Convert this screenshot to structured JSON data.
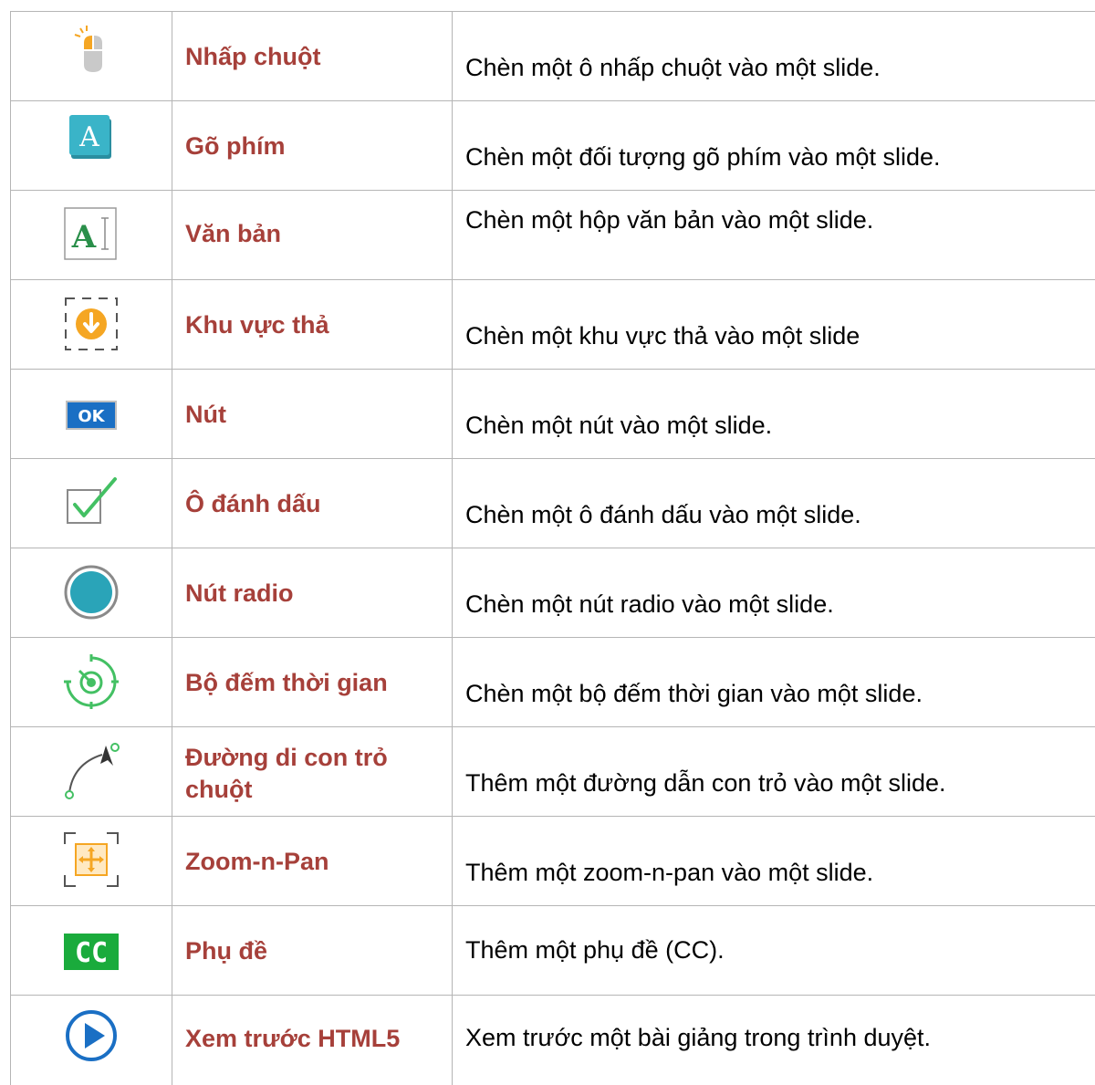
{
  "rows": [
    {
      "icon": "mouse-click-icon",
      "name": "Nhấp chuột",
      "desc": "Chèn một ô nhấp chuột vào một slide."
    },
    {
      "icon": "typing-icon",
      "name": "Gõ phím",
      "desc": "Chèn một đối tượng gõ phím vào một slide."
    },
    {
      "icon": "text-box-icon",
      "name": "Văn bản",
      "desc": "Chèn một hộp văn bản vào một slide."
    },
    {
      "icon": "drop-area-icon",
      "name": "Khu vực thả",
      "desc": "Chèn một khu vực thả vào một slide"
    },
    {
      "icon": "ok-button-icon",
      "name": "Nút",
      "desc": "Chèn một nút vào một slide."
    },
    {
      "icon": "checkbox-icon",
      "name": "Ô đánh dấu",
      "desc": "Chèn một ô đánh dấu vào một slide."
    },
    {
      "icon": "radio-button-icon",
      "name": "Nút radio",
      "desc": "Chèn một nút radio vào một slide."
    },
    {
      "icon": "timer-icon",
      "name": "Bộ đếm thời gian",
      "desc": "Chèn một bộ đếm thời gian vào một slide."
    },
    {
      "icon": "cursor-path-icon",
      "name": "Đường di con trỏ chuột",
      "desc": "Thêm một đường dẫn con trỏ vào một slide."
    },
    {
      "icon": "zoom-n-pan-icon",
      "name": "Zoom-n-Pan",
      "desc": "Thêm một zoom-n-pan vào một slide."
    },
    {
      "icon": "closed-caption-icon",
      "name": "Phụ đề",
      "desc": "Thêm một phụ đề (CC)."
    },
    {
      "icon": "play-preview-icon",
      "name": "Xem trước HTML5",
      "desc": "Xem trước một bài giảng trong trình duyệt."
    }
  ],
  "icon_labels": {
    "ok": "OK",
    "cc": "CC",
    "text_a": "A",
    "typing_a": "A"
  },
  "colors": {
    "name_text": "#a6403a",
    "teal": "#2aa4b8",
    "orange": "#f5a623",
    "green": "#43c063",
    "blue": "#1a6fc4",
    "cc_green": "#1aab3c"
  }
}
